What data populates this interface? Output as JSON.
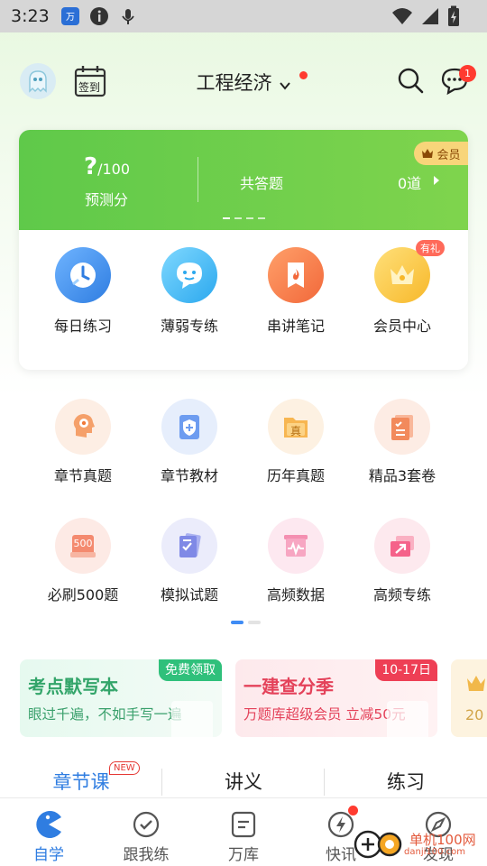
{
  "status_bar": {
    "time": "3:23"
  },
  "header": {
    "title": "工程经济",
    "checkin_label": "签到",
    "message_count": "1"
  },
  "card": {
    "score_value": "?",
    "score_total": "/100",
    "score_label": "预测分",
    "answered_label": "共答题",
    "answered_value": "0道",
    "vip_label": "会员",
    "quick": [
      {
        "label": "每日练习",
        "icon": "clock-check-icon"
      },
      {
        "label": "薄弱专练",
        "icon": "chat-bubble-icon"
      },
      {
        "label": "串讲笔记",
        "icon": "flame-bookmark-icon"
      },
      {
        "label": "会员中心",
        "icon": "crown-icon",
        "badge": "有礼"
      }
    ]
  },
  "grid": [
    {
      "label": "章节真题",
      "icon": "gear-head-icon"
    },
    {
      "label": "章节教材",
      "icon": "shield-book-icon"
    },
    {
      "label": "历年真题",
      "icon": "folder-zhen-icon",
      "glyph": "真"
    },
    {
      "label": "精品3套卷",
      "icon": "doc-stack-icon"
    },
    {
      "label": "必刷500题",
      "icon": "badge-500-icon",
      "glyph": "500"
    },
    {
      "label": "模拟试题",
      "icon": "checklist-icon"
    },
    {
      "label": "高频数据",
      "icon": "pulse-chart-icon"
    },
    {
      "label": "高频专练",
      "icon": "arrow-card-icon"
    }
  ],
  "banners": [
    {
      "title": "考点默写本",
      "subtitle": "眼过千遍，不如手写一遍",
      "tag": "免费领取"
    },
    {
      "title": "一建查分季",
      "subtitle": "万题库超级会员 立减50元",
      "tag": "10-17日"
    },
    {
      "text": "20"
    }
  ],
  "tabs": [
    {
      "label": "章节课",
      "badge": "NEW"
    },
    {
      "label": "讲义"
    },
    {
      "label": "练习"
    }
  ],
  "bottom_nav": [
    {
      "label": "自学",
      "icon": "pacman-icon"
    },
    {
      "label": "跟我练",
      "icon": "check-circle-icon"
    },
    {
      "label": "万库",
      "icon": "library-icon"
    },
    {
      "label": "快讯",
      "icon": "flash-icon"
    },
    {
      "label": "发现",
      "icon": "compass-icon"
    }
  ],
  "watermark": {
    "name": "单机100网",
    "url": "danji100.com"
  },
  "colors": {
    "accent": "#2f7de1",
    "green": "#6bcf4b",
    "red": "#ff3b30"
  }
}
